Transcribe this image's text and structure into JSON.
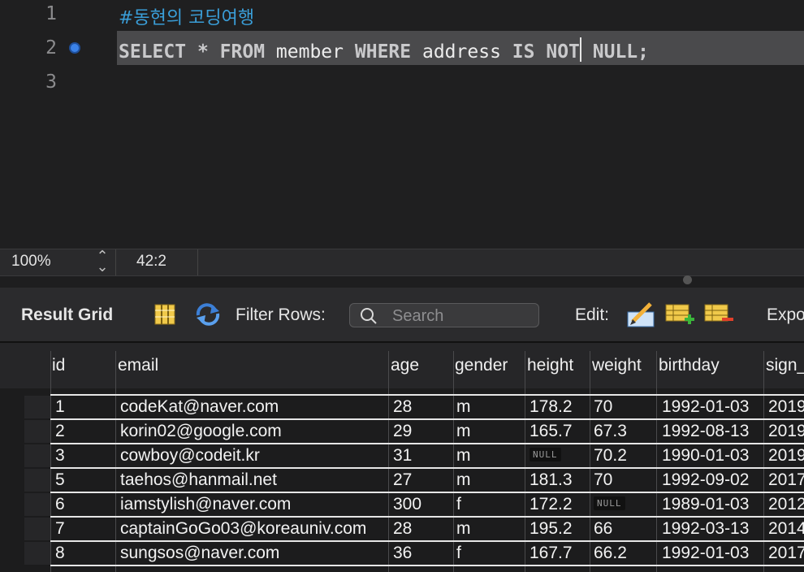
{
  "editor": {
    "line_numbers": [
      "1",
      "2",
      "3"
    ],
    "comment": "#동현의 코딩여행",
    "query": {
      "select": "SELECT",
      "star": "*",
      "from": "FROM",
      "table": "member",
      "where": "WHERE",
      "column": "address",
      "is": "IS",
      "not": "NOT",
      "null": "NULL;"
    }
  },
  "status": {
    "zoom": "100%",
    "cursor": "42:2"
  },
  "toolbar": {
    "result_grid": "Result Grid",
    "filter_rows": "Filter Rows:",
    "search_placeholder": "Search",
    "edit": "Edit:",
    "export": "Expo"
  },
  "grid": {
    "columns": [
      "id",
      "email",
      "age",
      "gender",
      "height",
      "weight",
      "birthday",
      "sign_"
    ],
    "rows": [
      [
        "1",
        "codeKat@naver.com",
        "28",
        "m",
        "178.2",
        "70",
        "1992-01-03",
        "2019"
      ],
      [
        "2",
        "korin02@google.com",
        "29",
        "m",
        "165.7",
        "67.3",
        "1992-08-13",
        "2019"
      ],
      [
        "3",
        "cowboy@codeit.kr",
        "31",
        "m",
        "NULL",
        "70.2",
        "1990-01-03",
        "2019"
      ],
      [
        "5",
        "taehos@hanmail.net",
        "27",
        "m",
        "181.3",
        "70",
        "1992-09-02",
        "2017"
      ],
      [
        "6",
        "iamstylish@naver.com",
        "300",
        "f",
        "172.2",
        "NULL",
        "1989-01-03",
        "2012"
      ],
      [
        "7",
        "captainGoGo03@koreauniv.com",
        "28",
        "m",
        "195.2",
        "66",
        "1992-03-13",
        "2014"
      ],
      [
        "8",
        "sungsos@naver.com",
        "36",
        "f",
        "167.7",
        "66.2",
        "1992-01-03",
        "2017"
      ]
    ]
  }
}
